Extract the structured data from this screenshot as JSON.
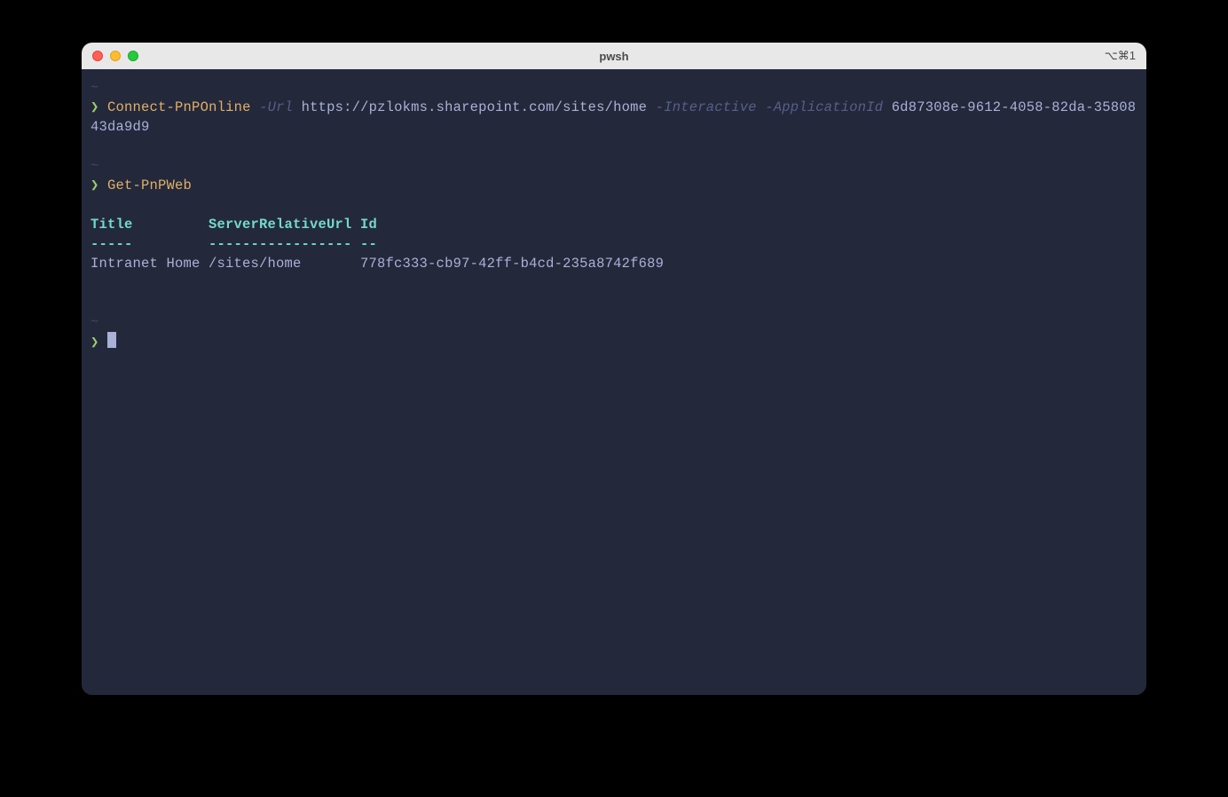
{
  "window": {
    "title": "pwsh",
    "shortcut": "⌥⌘1"
  },
  "blocks": [
    {
      "tilde": "~",
      "prompt": "❯ ",
      "segments": [
        {
          "cls": "cmd",
          "text": "Connect-PnPOnline"
        },
        {
          "cls": "arg",
          "text": " "
        },
        {
          "cls": "param",
          "text": "-Url"
        },
        {
          "cls": "arg",
          "text": " https://pzlokms.sharepoint.com/sites/home "
        },
        {
          "cls": "param",
          "text": "-Interactive"
        },
        {
          "cls": "arg",
          "text": " "
        },
        {
          "cls": "param",
          "text": "-ApplicationId"
        },
        {
          "cls": "arg",
          "text": " 6d87308e-9612-4058-82da-3580843da9d9"
        }
      ]
    },
    {
      "tilde": "~",
      "prompt": "❯ ",
      "segments": [
        {
          "cls": "cmd",
          "text": "Get-PnPWeb"
        }
      ]
    }
  ],
  "table": {
    "headers": "Title         ServerRelativeUrl Id",
    "separator": "-----         ----------------- --",
    "rows": [
      "Intranet Home /sites/home       778fc333-cb97-42ff-b4cd-235a8742f689"
    ]
  },
  "trailing": {
    "tilde": "~",
    "prompt": "❯ "
  }
}
